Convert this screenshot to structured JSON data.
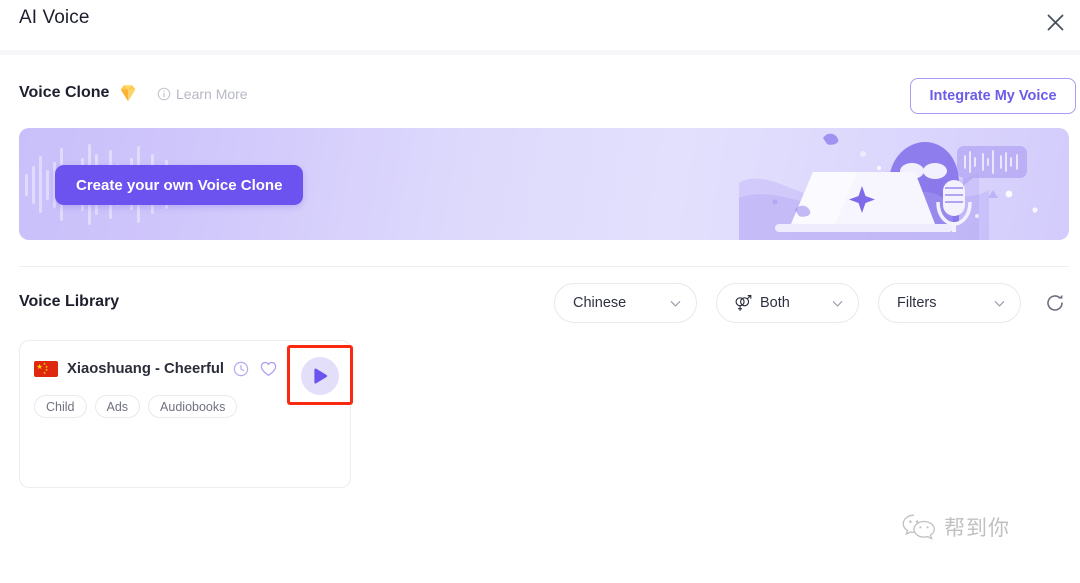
{
  "titlebar": {
    "title": "AI Voice",
    "close_label": "×",
    "close_icon": "close-icon"
  },
  "voice_clone": {
    "heading": "Voice Clone",
    "gem_icon": "diamond-gem-icon",
    "info_icon": "info-circle-icon",
    "learn_more_label": "Learn More",
    "integrate_button_label": "Integrate My Voice",
    "accent_color": "#6c5ce7",
    "border_color": "#a99bf7"
  },
  "banner": {
    "cta_label": "Create your own Voice Clone",
    "cta_color": "#6c52ef",
    "gradient_from": "#c9bffa",
    "gradient_to": "#d3ccfc",
    "illustration": "person-with-laptop-and-microphone-illustration"
  },
  "voice_library": {
    "heading": "Voice Library",
    "controls": [
      {
        "name": "language-dropdown",
        "label": "Chinese",
        "icon": null,
        "chevron": "chevron-down-icon"
      },
      {
        "name": "gender-dropdown",
        "label": "Both",
        "icon": "gender-symbol-icon",
        "chevron": "chevron-down-icon"
      },
      {
        "name": "filters-dropdown",
        "label": "Filters",
        "icon": null,
        "chevron": "chevron-down-icon"
      }
    ],
    "refresh_icon": "refresh-icon",
    "cards": [
      {
        "flag": "china-flag-icon",
        "name": "Xiaoshuang - Cheerful",
        "clock_icon": "clock-icon",
        "favorite_icon": "heart-icon",
        "play_icon": "play-icon",
        "highlighted": true,
        "highlight_color": "#fa2a11",
        "tags": [
          "Child",
          "Ads",
          "Audiobooks"
        ]
      }
    ]
  },
  "watermark": {
    "icon": "wechat-logo-icon",
    "text": "帮到你"
  }
}
